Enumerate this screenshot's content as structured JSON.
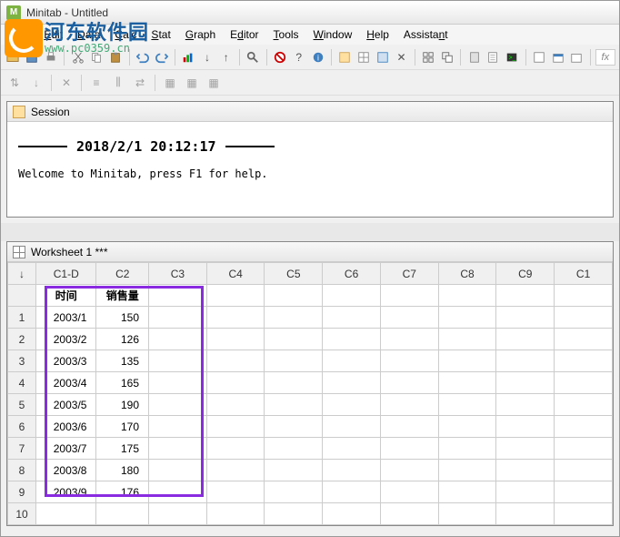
{
  "app": {
    "title": "Minitab - Untitled"
  },
  "menus": [
    "File",
    "Edit",
    "Data",
    "Calc",
    "Stat",
    "Graph",
    "Editor",
    "Tools",
    "Window",
    "Help",
    "Assistant"
  ],
  "overlay": {
    "cn": "河东软件园",
    "en": "www.pc0359.cn"
  },
  "session": {
    "panel_title": "Session",
    "timestamp": "2018/2/1 20:12:17",
    "welcome": "Welcome to Minitab, press F1 for help."
  },
  "worksheet": {
    "panel_title": "Worksheet 1 ***",
    "columns": [
      "C1-D",
      "C2",
      "C3",
      "C4",
      "C5",
      "C6",
      "C7",
      "C8",
      "C9",
      "C1"
    ],
    "colnames": [
      "时间",
      "销售量",
      "",
      "",
      "",
      "",
      "",
      "",
      "",
      ""
    ],
    "rows": [
      {
        "n": "1",
        "c1": "2003/1",
        "c2": "150"
      },
      {
        "n": "2",
        "c1": "2003/2",
        "c2": "126"
      },
      {
        "n": "3",
        "c1": "2003/3",
        "c2": "135"
      },
      {
        "n": "4",
        "c1": "2003/4",
        "c2": "165"
      },
      {
        "n": "5",
        "c1": "2003/5",
        "c2": "190"
      },
      {
        "n": "6",
        "c1": "2003/6",
        "c2": "170"
      },
      {
        "n": "7",
        "c1": "2003/7",
        "c2": "175"
      },
      {
        "n": "8",
        "c1": "2003/8",
        "c2": "180"
      },
      {
        "n": "9",
        "c1": "2003/9",
        "c2": "176"
      },
      {
        "n": "10",
        "c1": "",
        "c2": ""
      }
    ]
  },
  "fx": "fx",
  "chart_data": {
    "type": "table",
    "title": "销售量",
    "categories": [
      "2003/1",
      "2003/2",
      "2003/3",
      "2003/4",
      "2003/5",
      "2003/6",
      "2003/7",
      "2003/8",
      "2003/9"
    ],
    "values": [
      150,
      126,
      135,
      165,
      190,
      170,
      175,
      180,
      176
    ],
    "xlabel": "时间",
    "ylabel": "销售量"
  }
}
